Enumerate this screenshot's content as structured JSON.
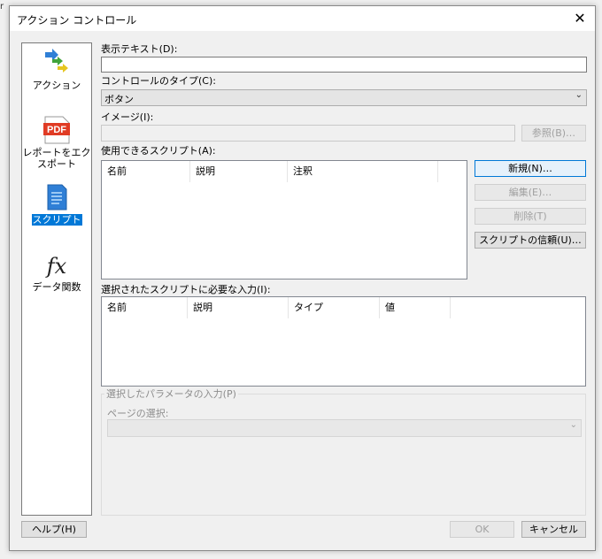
{
  "corner_mark": "r",
  "window": {
    "title": "アクション コントロール"
  },
  "sidebar": {
    "items": [
      {
        "label": "アクション",
        "icon": "action-arrows-icon"
      },
      {
        "label": "レポートをエクスポート",
        "icon": "pdf-icon"
      },
      {
        "label": "スクリプト",
        "icon": "script-document-icon",
        "selected": true
      },
      {
        "label": "データ関数",
        "icon": "function-fx-icon"
      }
    ]
  },
  "form": {
    "display_text_label": "表示テキスト(D):",
    "display_text_value": "",
    "control_type_label": "コントロールのタイプ(C):",
    "control_type_value": "ボタン",
    "image_label": "イメージ(I):",
    "image_value": "",
    "browse_button": "参照(B)…",
    "available_scripts_label": "使用できるスクリプト(A):",
    "scripts_columns": [
      "名前",
      "説明",
      "注釈"
    ],
    "new_button": "新規(N)…",
    "edit_button": "編集(E)…",
    "delete_button": "削除(T)",
    "trust_button": "スクリプトの信頼(U)…",
    "required_inputs_label": "選択されたスクリプトに必要な入力(I):",
    "inputs_columns": [
      "名前",
      "説明",
      "タイプ",
      "値"
    ],
    "param_group_label": "選択したパラメータの入力(P)",
    "page_select_label": "ページの選択:",
    "page_select_value": ""
  },
  "footer": {
    "help_button": "ヘルプ(H)",
    "ok_button": "OK",
    "cancel_button": "キャンセル"
  },
  "colors": {
    "selection": "#0078d7",
    "pdf_red": "#e03b24",
    "script_blue": "#2f7fd6"
  }
}
